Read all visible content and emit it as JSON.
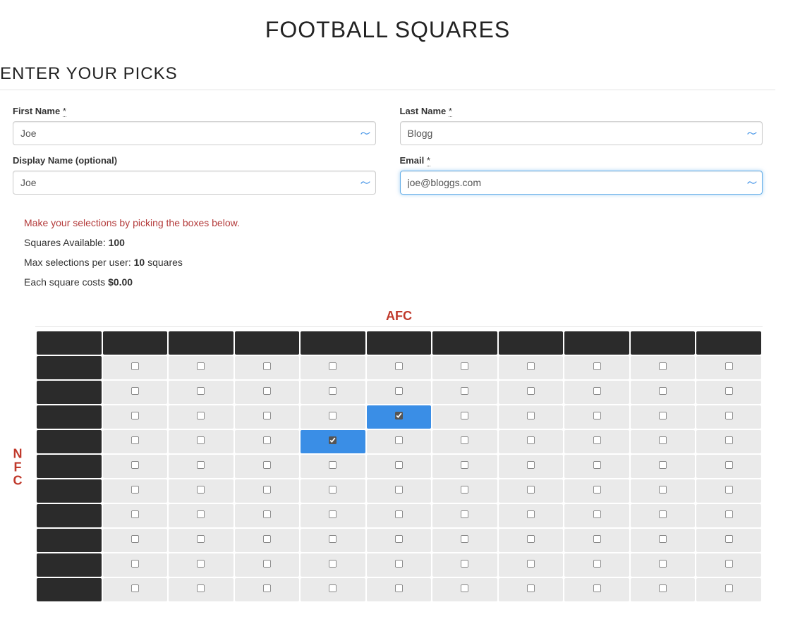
{
  "title": "FOOTBALL SQUARES",
  "subtitle": "ENTER YOUR PICKS",
  "form": {
    "first_name": {
      "label": "First Name",
      "req": "*",
      "value": "Joe"
    },
    "last_name": {
      "label": "Last Name",
      "req": "*",
      "value": "Blogg"
    },
    "display": {
      "label": "Display Name (optional)",
      "req": "",
      "value": "Joe"
    },
    "email": {
      "label": "Email",
      "req": "*",
      "value": "joe@bloggs.com"
    }
  },
  "info": {
    "hint": "Make your selections by picking the boxes below.",
    "squares_label": "Squares Available: ",
    "squares_value": "100",
    "max_label_pre": "Max selections per user: ",
    "max_value": "10",
    "max_label_post": " squares",
    "cost_label": "Each square costs ",
    "cost_value": "$0.00"
  },
  "grid": {
    "top_label": "AFC",
    "side_label": "NFC",
    "side_label_chars": [
      "N",
      "F",
      "C"
    ],
    "rows": 10,
    "cols": 10,
    "selected": [
      {
        "r": 2,
        "c": 4
      },
      {
        "r": 3,
        "c": 3
      }
    ]
  }
}
